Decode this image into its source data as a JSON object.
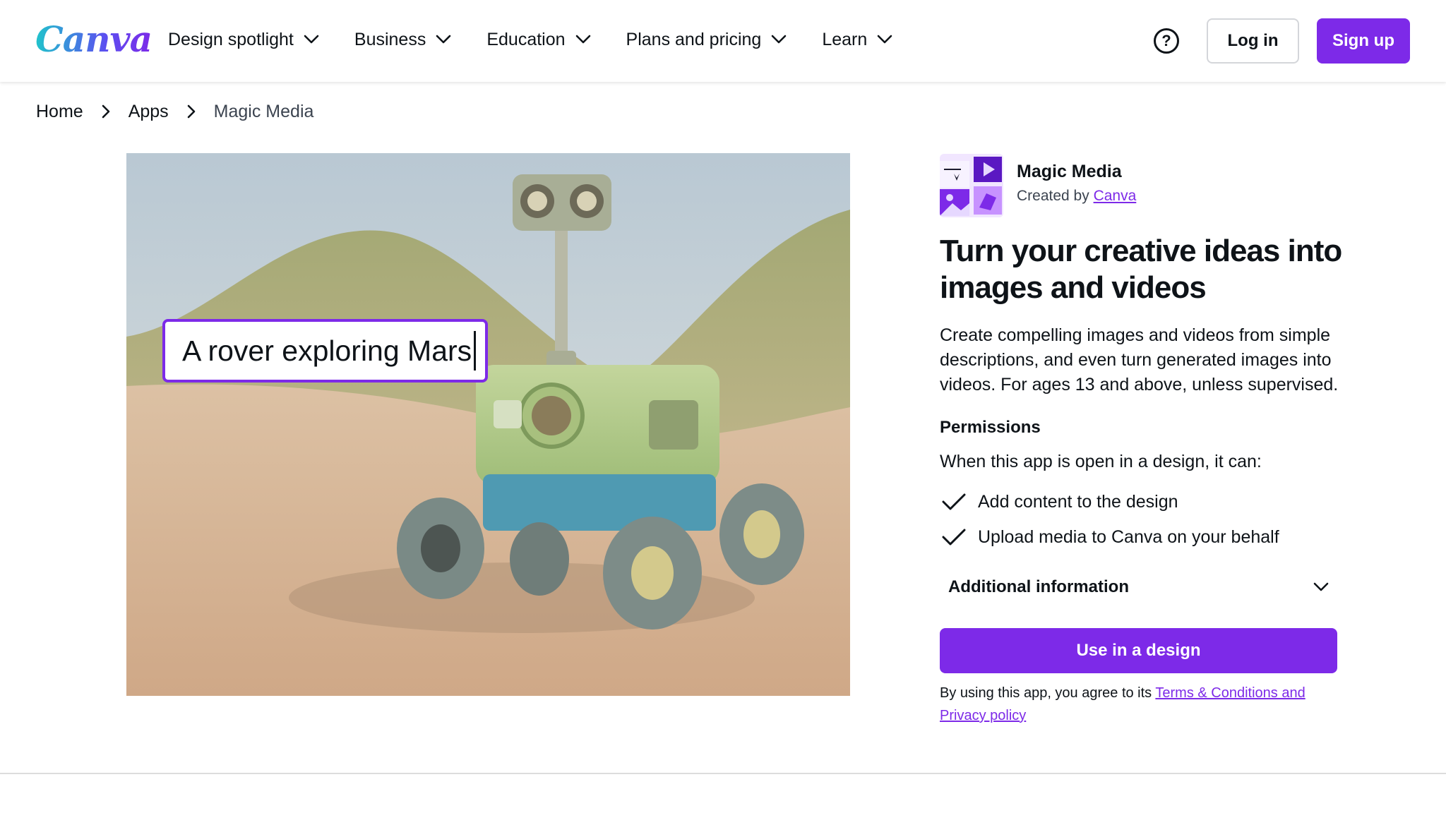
{
  "header": {
    "logo": "Canva",
    "nav": [
      {
        "label": "Design spotlight"
      },
      {
        "label": "Business"
      },
      {
        "label": "Education"
      },
      {
        "label": "Plans and pricing"
      },
      {
        "label": "Learn"
      }
    ],
    "help_icon_glyph": "?",
    "login_label": "Log in",
    "signup_label": "Sign up"
  },
  "breadcrumb": {
    "home": "Home",
    "apps": "Apps",
    "current": "Magic Media"
  },
  "hero": {
    "prompt_text": "A rover exploring Mars"
  },
  "app": {
    "name": "Magic Media",
    "created_by_prefix": "Created by",
    "creator": "Canva",
    "headline": "Turn your creative ideas into images and videos",
    "description": "Create compelling images and videos from simple descriptions, and even turn generated images into videos. For ages 13 and above, unless supervised.",
    "permissions_title": "Permissions",
    "permissions_intro": "When this app is open in a design, it can:",
    "permissions": [
      "Add content to the design",
      "Upload media to Canva on your behalf"
    ],
    "additional_info_label": "Additional information",
    "use_button_label": "Use in a design",
    "terms_prefix": "By using this app, you agree to its",
    "terms_link": "Terms & Conditions and Privacy policy"
  },
  "icons": {
    "nav_chevron": "chevron-down-icon",
    "breadcrumb_separator": "chevron-right-icon",
    "help": "help-circle-icon",
    "permission": "check-icon",
    "accordion": "chevron-down-icon"
  },
  "colors": {
    "brand_purple": "#7d2ae8",
    "text": "#0e1318",
    "muted_text": "#3c4450"
  }
}
